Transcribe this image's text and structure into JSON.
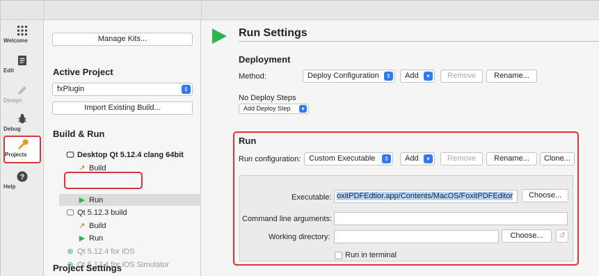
{
  "modes": [
    {
      "id": "welcome",
      "label": "Welcome",
      "icon": "grid-icon"
    },
    {
      "id": "edit",
      "label": "Edit",
      "icon": "document-icon"
    },
    {
      "id": "design",
      "label": "Design",
      "icon": "pencil-icon"
    },
    {
      "id": "debug",
      "label": "Debug",
      "icon": "bug-icon"
    },
    {
      "id": "projects",
      "label": "Projects",
      "icon": "wrench-icon"
    },
    {
      "id": "help",
      "label": "Help",
      "icon": "question-icon"
    }
  ],
  "project_panel": {
    "manage_kits": "Manage Kits...",
    "active_project_heading": "Active Project",
    "active_project_value": "fxPlugin",
    "import_build": "Import Existing Build...",
    "build_run_heading": "Build & Run",
    "kits": [
      {
        "label": "Desktop Qt 5.12.4 clang 64bit",
        "build": "Build",
        "run": "Run"
      },
      {
        "label": "Qt 5.12.3 build",
        "build": "Build",
        "run": "Run"
      }
    ],
    "disabled_kits": [
      "Qt 5.12.4 for iOS",
      "Qt 5.12.4 for iOS Simulator"
    ],
    "project_settings_heading": "Project Settings"
  },
  "run_settings": {
    "title": "Run Settings",
    "deployment": {
      "heading": "Deployment",
      "method_label": "Method:",
      "method_value": "Deploy Configuration",
      "add": "Add",
      "remove": "Remove",
      "rename": "Rename...",
      "no_steps": "No Deploy Steps",
      "add_step": "Add Deploy Step"
    },
    "run": {
      "heading": "Run",
      "config_label": "Run configuration:",
      "config_value": "Custom Executable",
      "add": "Add",
      "remove": "Remove",
      "rename": "Rename...",
      "clone": "Clone...",
      "executable_label": "Executable:",
      "executable_value": "oxitPDFEdtior.app/Contents/MacOS/FoxitPDFEditor",
      "choose": "Choose...",
      "args_label": "Command line arguments:",
      "args_value": "",
      "workdir_label": "Working directory:",
      "workdir_value": "",
      "choose2": "Choose...",
      "run_in_terminal": "Run in terminal"
    }
  },
  "colors": {
    "accent": "#2f7bf5",
    "highlight_box": "#d9343b",
    "run_green": "#2fb34a"
  }
}
